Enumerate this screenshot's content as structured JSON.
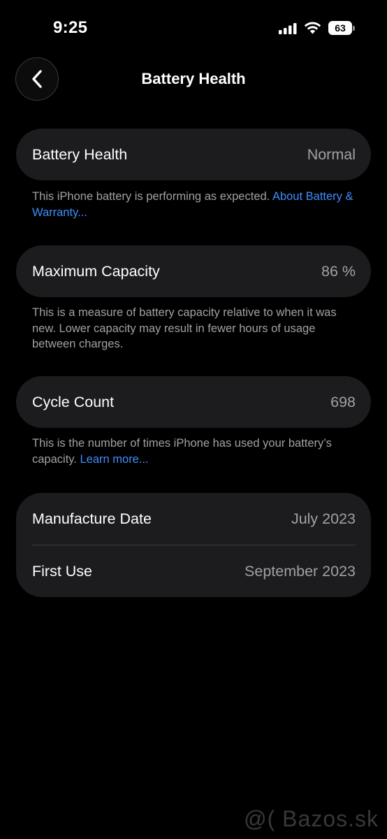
{
  "status_bar": {
    "time": "9:25",
    "battery_level": "63",
    "icons": [
      "signal-icon",
      "wifi-icon",
      "battery-icon"
    ]
  },
  "nav": {
    "title": "Battery Health",
    "back_icon": "chevron-left-icon"
  },
  "battery_health": {
    "label": "Battery Health",
    "value": "Normal",
    "footnote": "This iPhone battery is performing as expected.",
    "link": "About Battery & Warranty..."
  },
  "maximum_capacity": {
    "label": "Maximum Capacity",
    "value": "86 %",
    "footnote": "This is a measure of battery capacity relative to when it was new. Lower capacity may result in fewer hours of usage between charges."
  },
  "cycle_count": {
    "label": "Cycle Count",
    "value": "698",
    "footnote": "This is the number of times iPhone has used your battery’s capacity.",
    "link": "Learn more..."
  },
  "dates": {
    "manufacture_label": "Manufacture Date",
    "manufacture_value": "July 2023",
    "first_use_label": "First Use",
    "first_use_value": "September 2023"
  },
  "watermark": "@( Bazos.sk",
  "colors": {
    "background": "#000000",
    "card": "#1c1c1e",
    "secondary_text": "#a1a1a6",
    "link": "#3f8efc",
    "divider": "#3a3a3c"
  }
}
